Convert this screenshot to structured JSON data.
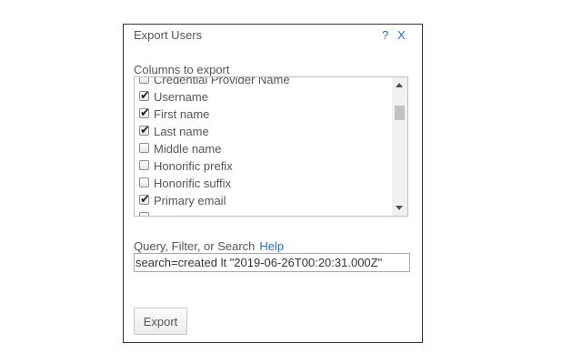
{
  "dialog": {
    "title": "Export Users",
    "help_label": "?",
    "close_label": "X"
  },
  "columns": {
    "label": "Columns to export",
    "items": [
      {
        "label": "Credential Provider Name",
        "checked": false
      },
      {
        "label": "Username",
        "checked": true
      },
      {
        "label": "First name",
        "checked": true
      },
      {
        "label": "Last name",
        "checked": true
      },
      {
        "label": "Middle name",
        "checked": false
      },
      {
        "label": "Honorific prefix",
        "checked": false
      },
      {
        "label": "Honorific suffix",
        "checked": false
      },
      {
        "label": "Primary email",
        "checked": true
      },
      {
        "label": "",
        "checked": false
      }
    ]
  },
  "query": {
    "label": "Query, Filter, or Search",
    "help_link": "Help",
    "value": "search=created lt \"2019-06-26T00:20:31.000Z\""
  },
  "export_button": "Export",
  "colors": {
    "link": "#2a6ebb",
    "text": "#555555",
    "border": "#333333"
  }
}
